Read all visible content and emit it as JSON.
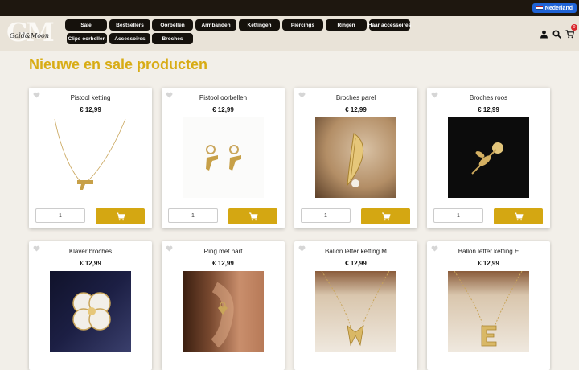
{
  "topbar": {
    "language": "Nederland"
  },
  "header": {
    "logo_initials": "GM",
    "logo_script": "Gold&Moon",
    "cart_count": "0",
    "nav": [
      {
        "label": "Sale"
      },
      {
        "label": "Bestsellers"
      },
      {
        "label": "Oorbellen"
      },
      {
        "label": "Armbanden"
      },
      {
        "label": "Kettingen"
      },
      {
        "label": "Piercings"
      },
      {
        "label": "Ringen"
      },
      {
        "label": "Haar accessoires"
      },
      {
        "label": "Clips oorbellen"
      },
      {
        "label": "Accessoires"
      },
      {
        "label": "Broches"
      }
    ]
  },
  "page": {
    "title": "Nieuwe en sale producten"
  },
  "colors": {
    "accent": "#d4a712",
    "title": "#d8ac15",
    "nav_pill": "#15110c",
    "topbar": "#1e170f"
  },
  "products": [
    {
      "name": "Pistool ketting",
      "price": "€ 12,99",
      "qty": "1"
    },
    {
      "name": "Pistool oorbellen",
      "price": "€ 12,99",
      "qty": "1"
    },
    {
      "name": "Broches parel",
      "price": "€ 12,99",
      "qty": "1"
    },
    {
      "name": "Broches roos",
      "price": "€ 12,99",
      "qty": "1"
    },
    {
      "name": "Klaver broches",
      "price": "€ 12,99"
    },
    {
      "name": "Ring met hart",
      "price": "€ 12,99"
    },
    {
      "name": "Ballon letter ketting M",
      "price": "€ 12,99"
    },
    {
      "name": "Ballon letter ketting E",
      "price": "€ 12,99"
    }
  ]
}
